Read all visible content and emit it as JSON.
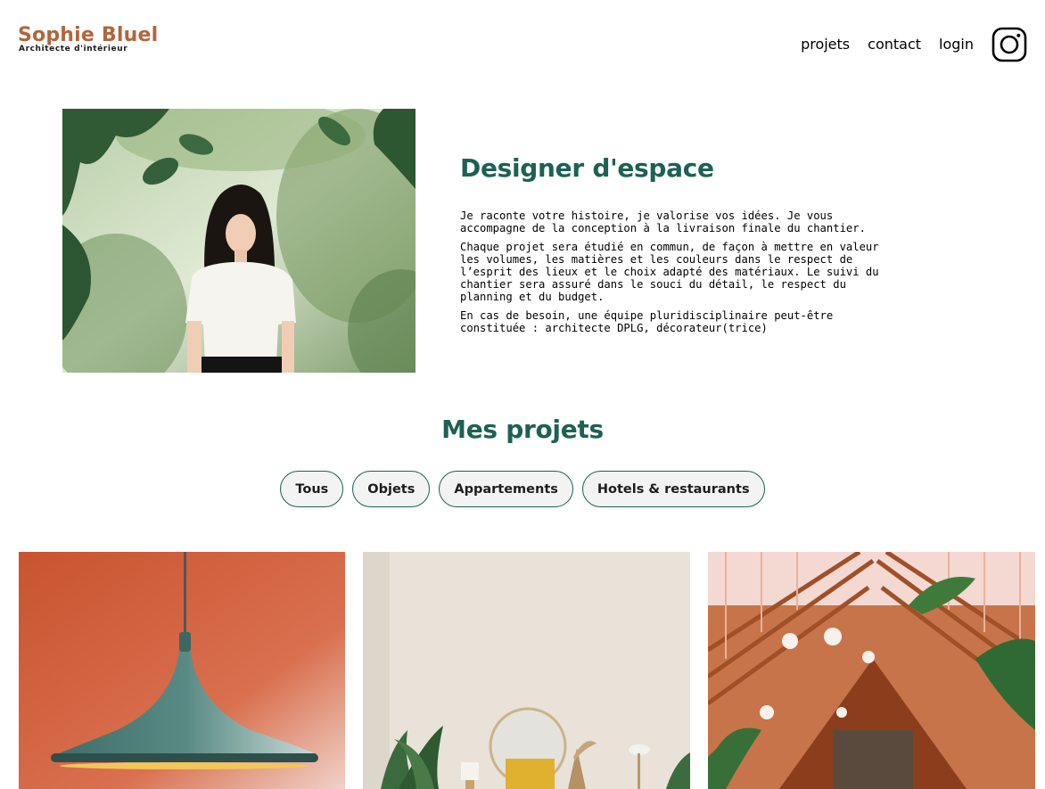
{
  "header": {
    "logo_title": "Sophie Bluel",
    "logo_subtitle": "Architecte d'intérieur",
    "nav": [
      {
        "label": "projets"
      },
      {
        "label": "contact"
      },
      {
        "label": "login"
      }
    ],
    "social_icon": "instagram-icon"
  },
  "introduction": {
    "title": "Designer d'espace",
    "paragraphs": [
      "Je raconte votre histoire, je valorise vos idées. Je vous accompagne de la conception à la livraison finale du chantier.",
      "Chaque projet sera étudié en commun, de façon à mettre en valeur les volumes, les matières et les couleurs dans le respect de l’esprit des lieux et le choix adapté des matériaux. Le suivi du chantier sera assuré dans le souci du détail, le respect du planning et du budget.",
      "En cas de besoin, une équipe pluridisciplinaire peut-être constituée : architecte DPLG, décorateur(trice)"
    ]
  },
  "portfolio": {
    "title": "Mes projets",
    "filters": [
      {
        "label": "Tous"
      },
      {
        "label": "Objets"
      },
      {
        "label": "Appartements"
      },
      {
        "label": "Hotels & restaurants"
      }
    ]
  },
  "colors": {
    "brand": "#B1663C",
    "accent": "#1D6154"
  }
}
